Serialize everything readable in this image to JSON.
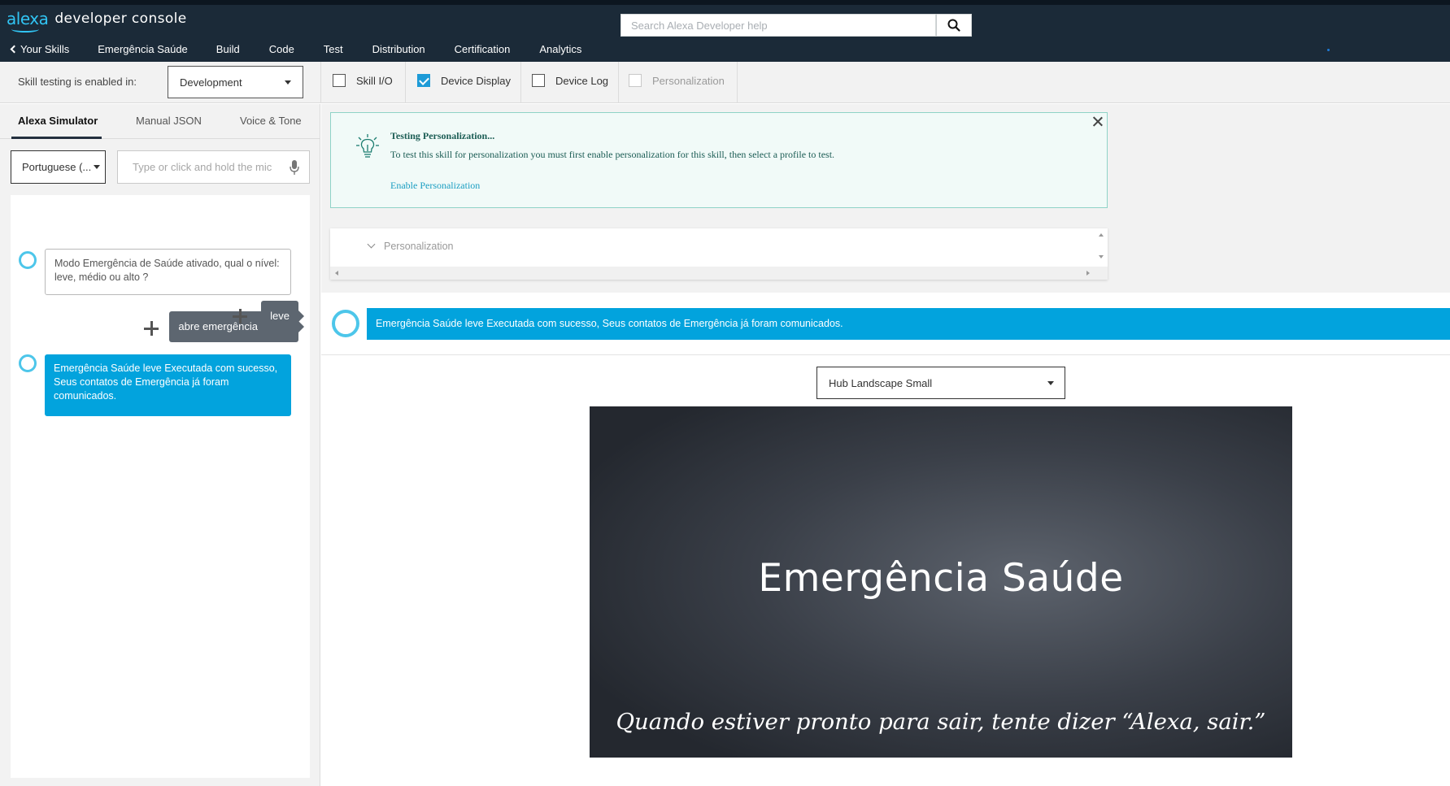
{
  "header": {
    "brand_logo": "alexa",
    "brand_text": "developer console",
    "search_placeholder": "Search Alexa Developer help",
    "search_icon": "magnifier-icon"
  },
  "nav": {
    "items": [
      {
        "label": "Your Skills"
      },
      {
        "label": "Emergência Saúde"
      },
      {
        "label": "Build"
      },
      {
        "label": "Code"
      },
      {
        "label": "Test",
        "active": true
      },
      {
        "label": "Distribution"
      },
      {
        "label": "Certification"
      },
      {
        "label": "Analytics"
      }
    ]
  },
  "toolbar": {
    "enabled_label": "Skill testing is enabled in:",
    "stage_value": "Development",
    "checks": [
      {
        "label": "Skill I/O",
        "checked": false
      },
      {
        "label": "Device Display",
        "checked": true
      },
      {
        "label": "Device Log",
        "checked": false
      },
      {
        "label": "Personalization",
        "checked": false,
        "disabled": true
      }
    ]
  },
  "left_tabs": [
    "Alexa Simulator",
    "Manual JSON",
    "Voice & Tone"
  ],
  "simulator": {
    "language_value": "Portuguese (...",
    "input_placeholder": "Type or click and hold the mic",
    "messages": [
      {
        "from": "user",
        "text": "abre emergência saúde"
      },
      {
        "from": "alexa",
        "text": "Modo Emergência de Saúde ativado, qual o nível: leve, médio ou alto ?"
      },
      {
        "from": "user",
        "text": "leve"
      },
      {
        "from": "alexa",
        "text": "Emergência Saúde leve Executada com sucesso, Seus contatos de Emergência já foram comunicados."
      }
    ]
  },
  "personalization_notice": {
    "title": "Testing Personalization...",
    "text": "To test this skill for personalization you must first enable personalization for this skill, then select a profile to test.",
    "link": "Enable Personalization"
  },
  "personalization_panel": {
    "label": "Personalization"
  },
  "response_bar": {
    "text": "Emergência Saúde leve Executada com sucesso, Seus contatos de Emergência já foram comunicados."
  },
  "device": {
    "selected": "Hub Landscape Small",
    "screen_title": "Emergência Saúde",
    "screen_hint": "Quando estiver pronto para sair, tente dizer “Alexa, sair.”"
  },
  "colors": {
    "header_bg": "#1b2a38",
    "accent_blue": "#02a3dd",
    "alexa_ring": "#4dc6ea",
    "notice_bg": "#f1faf8",
    "notice_border": "#8fd3c7"
  }
}
